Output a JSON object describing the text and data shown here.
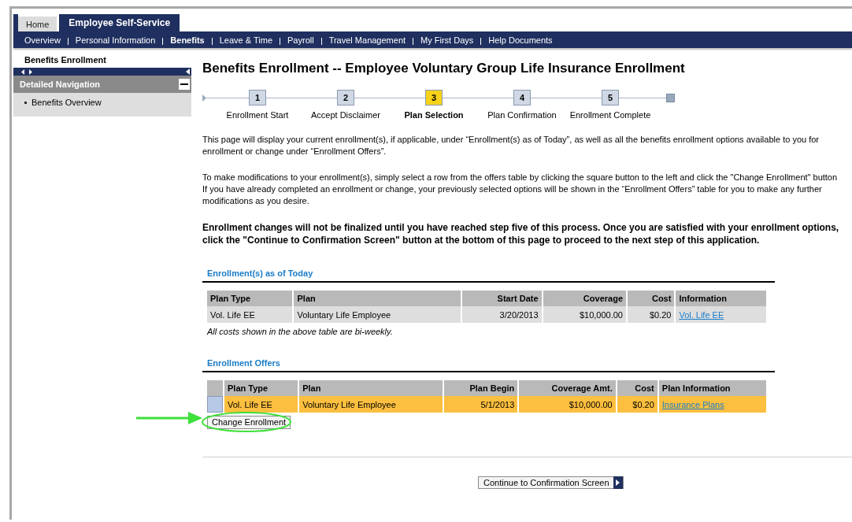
{
  "tabs": [
    {
      "label": "Home",
      "selected": false
    },
    {
      "label": "Employee Self-Service",
      "selected": true
    }
  ],
  "nav": [
    {
      "label": "Overview",
      "selected": false
    },
    {
      "label": "Personal Information",
      "selected": false
    },
    {
      "label": "Benefits",
      "selected": true
    },
    {
      "label": "Leave & Time",
      "selected": false
    },
    {
      "label": "Payroll",
      "selected": false
    },
    {
      "label": "Travel Management",
      "selected": false
    },
    {
      "label": "My First Days",
      "selected": false
    },
    {
      "label": "Help Documents",
      "selected": false
    }
  ],
  "breadcrumb": "Benefits Enrollment",
  "sidebar": {
    "title": "Detailed Navigation",
    "items": [
      {
        "label": "Benefits Overview"
      }
    ]
  },
  "title": "Benefits Enrollment -- Employee Voluntary Group Life Insurance Enrollment",
  "steps": [
    {
      "number": "1",
      "label": "Enrollment Start",
      "selected": false
    },
    {
      "number": "2",
      "label": "Accept Disclaimer",
      "selected": false
    },
    {
      "number": "3",
      "label": "Plan Selection",
      "selected": true
    },
    {
      "number": "4",
      "label": "Plan Confirmation",
      "selected": false
    },
    {
      "number": "5",
      "label": "Enrollment Complete",
      "selected": false
    }
  ],
  "paragraphs": [
    {
      "text": "This page will display your current enrollment(s), if applicable, under “Enrollment(s) as of Today”, as well as all the benefits enrollment options available to you for enrollment or change under “Enrollment Offers”.",
      "emphasis": false
    },
    {
      "text": "To make modifications to your enrollment(s), simply select a row from the offers table by clicking the square button to the left and click the \"Change Enrollment\" button  If you have already completed an enrollment or change, your previously selected options will be shown in the “Enrollment Offers” table for you to make any further modifications as you desire.",
      "emphasis": false
    },
    {
      "text": "Enrollment changes will not be finalized until you have reached step five of this process.  Once you are satisfied with your enrollment options, click the \"Continue to Confirmation Screen\" button at the bottom of this page to proceed to the next step of this application.",
      "emphasis": true
    }
  ],
  "current": {
    "heading": "Enrollment(s) as of Today",
    "columns": [
      "Plan Type",
      "Plan",
      "Start Date",
      "Coverage",
      "Cost",
      "Information"
    ],
    "rows": [
      {
        "cells": [
          "Vol. Life EE",
          "Voluntary Life Employee",
          "3/20/2013",
          "$10,000.00",
          "$0.20"
        ],
        "link": "Vol. Life EE"
      }
    ],
    "note": "All costs shown in the above table are bi-weekly."
  },
  "offers": {
    "heading": "Enrollment Offers",
    "columns": [
      "Plan Type",
      "Plan",
      "Plan Begin",
      "Coverage Amt.",
      "Cost",
      "Plan Information"
    ],
    "rows": [
      {
        "selected": true,
        "cells": [
          "Vol. Life EE",
          "Voluntary Life Employee",
          "5/1/2013",
          "$10,000.00",
          "$0.20"
        ],
        "link": "Insurance Plans"
      }
    ],
    "button": "Change Enrollment"
  },
  "continue_button": "Continue to Confirmation Screen"
}
